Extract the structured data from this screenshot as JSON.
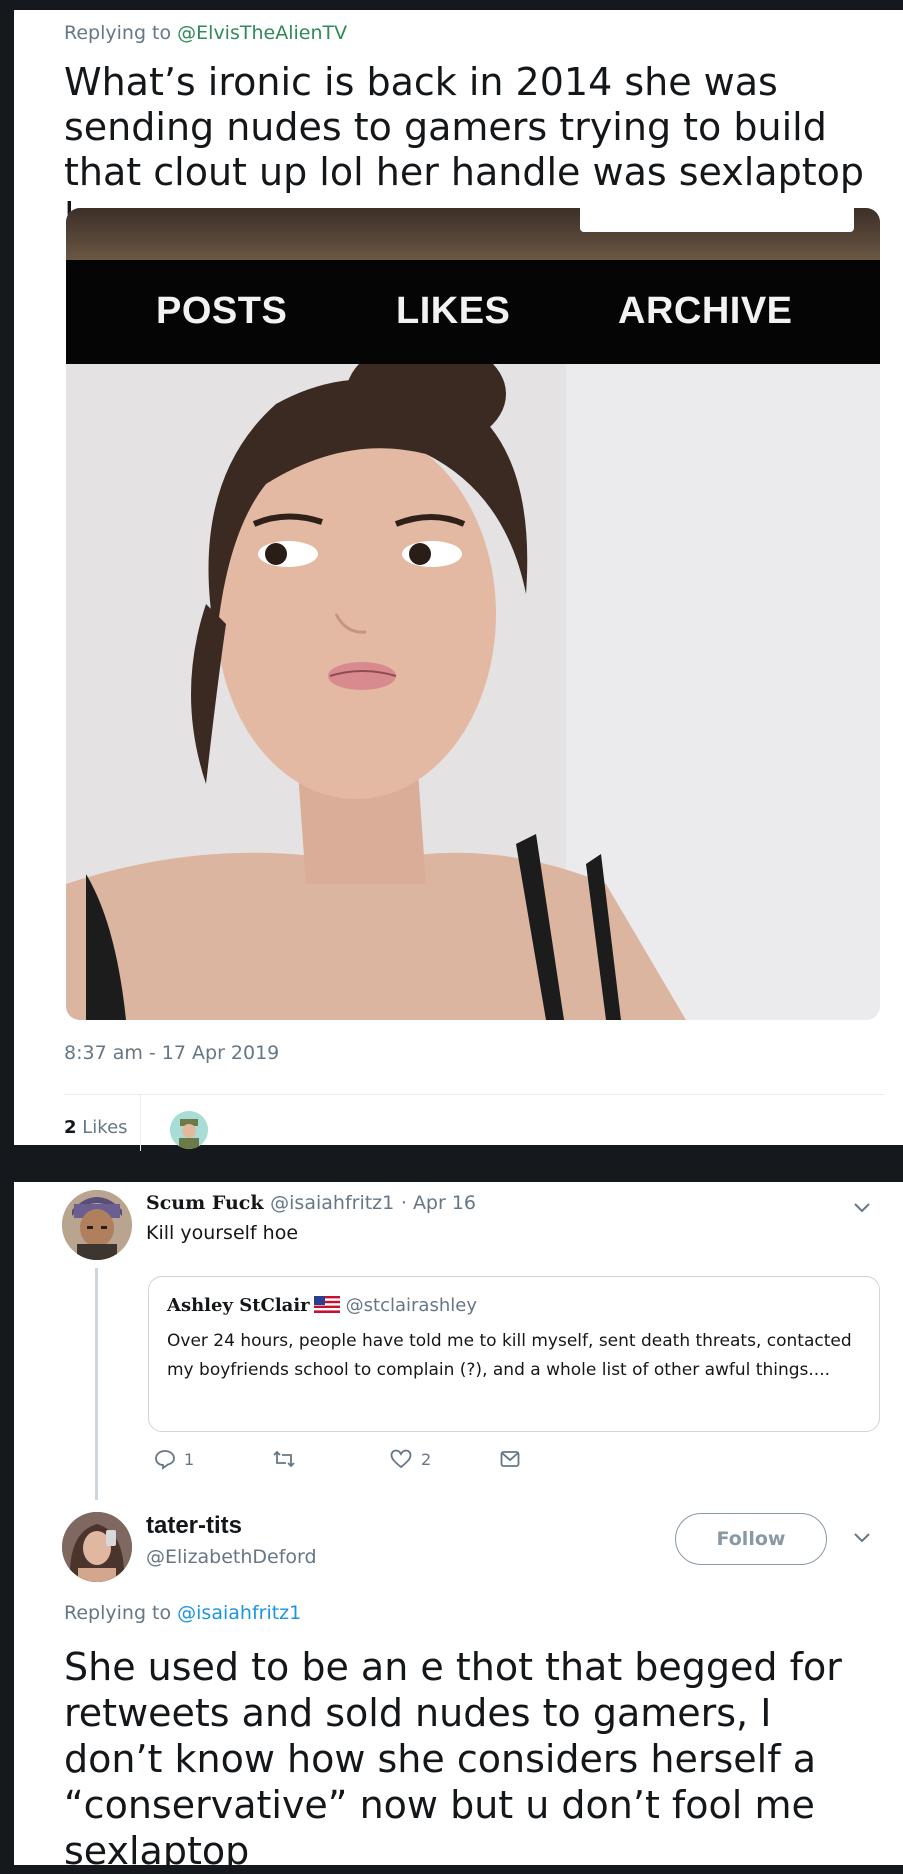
{
  "tweet1": {
    "replying_prefix": "Replying to ",
    "replying_handle": "@ElvisTheAlienTV",
    "text": "What’s ironic is back in 2014 she was sending nudes to gamers trying to build that clout up lol her handle was sexlaptop lmao",
    "media": {
      "nav_tabs": [
        "POSTS",
        "LIKES",
        "ARCHIVE"
      ]
    },
    "timestamp": "8:37 am - 17 Apr 2019",
    "likes_count": "2",
    "likes_label": "Likes"
  },
  "tweet2": {
    "name": "Scum Fuck",
    "handle": "@isaiahfritz1",
    "date": "· Apr 16",
    "text": "Kill yourself hoe",
    "quote": {
      "name": "Ashley StClair",
      "handle": "@stclairashley",
      "text": "Over 24 hours, people have told me to kill myself, sent death threats, contacted my boyfriends school to complain (?), and a whole list of other awful things...."
    },
    "actions": {
      "reply_count": "1",
      "retweet_count": "",
      "like_count": "2"
    }
  },
  "tweet3": {
    "name": "tater-tits",
    "handle": "@ElizabethDeford",
    "follow_label": "Follow",
    "replying_prefix": "Replying to ",
    "replying_handle": "@isaiahfritz1",
    "text": "She used to be an e thot that begged for retweets and sold nudes to gamers, I don’t know how she considers herself a “conservative” now but u don’t fool me sexlaptop"
  },
  "colors": {
    "background": "#15181c",
    "text_primary": "#14171a",
    "text_secondary": "#657786",
    "link": "#1b95e0"
  }
}
